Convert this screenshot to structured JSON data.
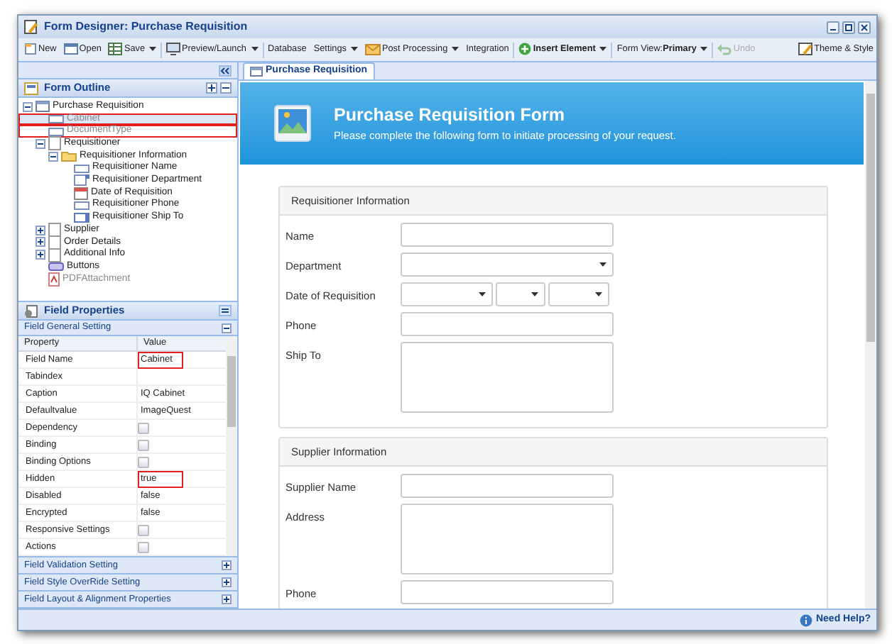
{
  "window": {
    "title": "Form Designer: Purchase Requisition"
  },
  "toolbar": [
    {
      "label": "New",
      "kind": "new",
      "dropdown": false,
      "disabled": false
    },
    {
      "label": "Open",
      "kind": "open",
      "dropdown": false,
      "disabled": false
    },
    {
      "label": "Save",
      "kind": "save",
      "dropdown": true,
      "disabled": false
    },
    {
      "label": "Preview/Launch",
      "kind": "preview",
      "dropdown": true,
      "disabled": false
    },
    {
      "label": "Database",
      "kind": "text",
      "dropdown": false,
      "disabled": false
    },
    {
      "label": "Settings",
      "kind": "text",
      "dropdown": true,
      "disabled": false
    },
    {
      "label": "Post Processing",
      "kind": "mail",
      "dropdown": true,
      "disabled": false
    },
    {
      "label": "Integration",
      "kind": "text",
      "dropdown": false,
      "disabled": false
    },
    {
      "label": "**Insert Element**",
      "kind": "add",
      "dropdown": true,
      "disabled": false
    },
    {
      "label": "Form View:**Primary**",
      "kind": "text",
      "dropdown": true,
      "disabled": false
    },
    {
      "label": "Undo",
      "kind": "undo",
      "dropdown": false,
      "disabled": true
    }
  ],
  "theme_button": {
    "label": "Theme & Style"
  },
  "form_outline": {
    "title": "Form Outline",
    "tree": [
      {
        "label": "Purchase Requisition",
        "kind": "form",
        "expanded": true,
        "selected": false,
        "disabled": false,
        "annotated": false,
        "children": [
          {
            "label": "Cabinet",
            "kind": "field",
            "selected": true,
            "disabled": true,
            "annotated": true
          },
          {
            "label": "DocumentType",
            "kind": "field",
            "selected": false,
            "disabled": true,
            "annotated": true
          },
          {
            "label": "Requisitioner",
            "kind": "page",
            "expanded": true,
            "selected": false,
            "disabled": false,
            "annotated": false,
            "children": [
              {
                "label": "Requisitioner Information",
                "kind": "folder",
                "expanded": true,
                "selected": false,
                "disabled": false,
                "annotated": false,
                "children": [
                  {
                    "label": "Requisitioner Name",
                    "kind": "field",
                    "selected": false,
                    "disabled": false,
                    "annotated": false
                  },
                  {
                    "label": "Requisitioner Department",
                    "kind": "select",
                    "selected": false,
                    "disabled": false,
                    "annotated": false
                  },
                  {
                    "label": "Date of Requisition",
                    "kind": "date",
                    "selected": false,
                    "disabled": false,
                    "annotated": false
                  },
                  {
                    "label": "Requisitioner Phone",
                    "kind": "field",
                    "selected": false,
                    "disabled": false,
                    "annotated": false
                  },
                  {
                    "label": "Requisitioner Ship To",
                    "kind": "textarea",
                    "selected": false,
                    "disabled": false,
                    "annotated": false
                  }
                ]
              }
            ]
          },
          {
            "label": "Supplier",
            "kind": "page",
            "expanded": false,
            "selected": false,
            "disabled": false,
            "annotated": false
          },
          {
            "label": "Order Details",
            "kind": "page",
            "expanded": false,
            "selected": false,
            "disabled": false,
            "annotated": false
          },
          {
            "label": "Additional Info",
            "kind": "page",
            "expanded": false,
            "selected": false,
            "disabled": false,
            "annotated": false
          },
          {
            "label": "Buttons",
            "kind": "buttons",
            "selected": false,
            "disabled": false,
            "annotated": false
          },
          {
            "label": "PDFAttachment",
            "kind": "pdf",
            "selected": false,
            "disabled": true,
            "annotated": false
          }
        ]
      }
    ]
  },
  "field_properties": {
    "title": "Field Properties",
    "general": {
      "title": "Field General Setting",
      "expanded": true
    },
    "columns": [
      "Property",
      "Value"
    ],
    "rows": [
      {
        "property": "Field Name",
        "value": "Cabinet",
        "kind": "text",
        "annotated": true
      },
      {
        "property": "Tabindex",
        "kind": "text",
        "annotated": false
      },
      {
        "property": "Caption",
        "value": "IQ Cabinet",
        "kind": "text",
        "annotated": false
      },
      {
        "property": "Defaultvalue",
        "value": "ImageQuest",
        "kind": "text",
        "annotated": false
      },
      {
        "property": "Dependency",
        "kind": "button",
        "annotated": false
      },
      {
        "property": "Binding",
        "kind": "button",
        "annotated": false
      },
      {
        "property": "Binding Options",
        "kind": "button",
        "annotated": false
      },
      {
        "property": "Hidden",
        "value": "true",
        "kind": "text",
        "annotated": true
      },
      {
        "property": "Disabled",
        "value": "false",
        "kind": "text",
        "annotated": false
      },
      {
        "property": "Encrypted",
        "value": "false",
        "kind": "text",
        "annotated": false
      },
      {
        "property": "Responsive Settings",
        "kind": "button",
        "annotated": false
      },
      {
        "property": "Actions",
        "kind": "button",
        "annotated": false
      }
    ],
    "sections": [
      {
        "title": "Field Validation Setting",
        "expanded": false
      },
      {
        "title": "Field Style OverRide Setting",
        "expanded": false
      },
      {
        "title": "Field Layout & Alignment Properties",
        "expanded": false
      }
    ]
  },
  "tabs": [
    {
      "label": "Purchase Requisition",
      "selected": true
    }
  ],
  "form": {
    "title": "Purchase Requisition Form",
    "subtitle": "Please complete the following form to initiate processing of your request.",
    "sections": [
      {
        "title": "Requisitioner Information",
        "fields": [
          {
            "label": "Name",
            "kind": "text"
          },
          {
            "label": "Department",
            "kind": "select"
          },
          {
            "label": "Date of Requisition",
            "kind": "date"
          },
          {
            "label": "Phone",
            "kind": "text"
          },
          {
            "label": "Ship To",
            "kind": "textarea"
          }
        ]
      },
      {
        "title": "Supplier Information",
        "fields": [
          {
            "label": "Supplier Name",
            "kind": "text"
          },
          {
            "label": "Address",
            "kind": "textarea"
          },
          {
            "label": "Phone",
            "kind": "text"
          }
        ]
      }
    ]
  },
  "status_bar": {
    "help": "Need Help?"
  }
}
